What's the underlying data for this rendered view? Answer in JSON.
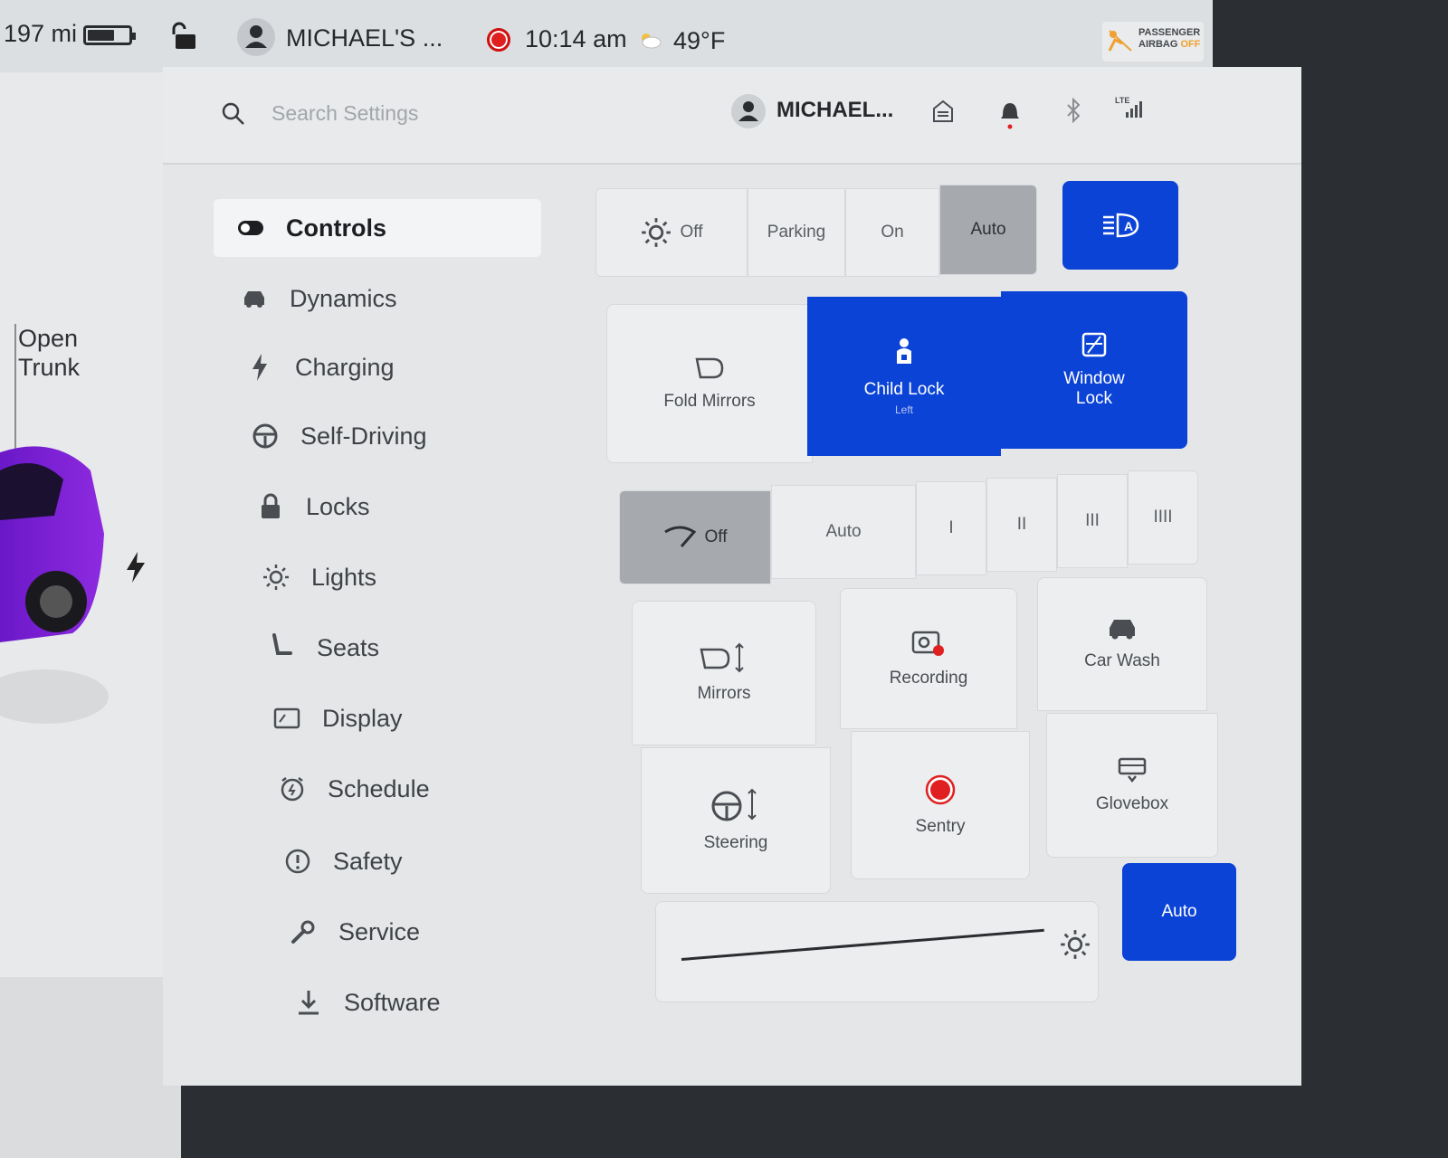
{
  "status_bar": {
    "range": "197 mi",
    "battery_level": 0.65,
    "profile": "MICHAEL'S ...",
    "time": "10:14 am",
    "temperature": "49°F",
    "airbag_line1": "PASSENGER",
    "airbag_line2": "AIRBAG",
    "airbag_state": "OFF"
  },
  "car_panel": {
    "trunk_line1": "Open",
    "trunk_line2": "Trunk"
  },
  "header": {
    "search_placeholder": "Search Settings",
    "profile_name": "MICHAEL...",
    "signal_label": "LTE"
  },
  "nav": {
    "items": [
      {
        "label": "Controls",
        "icon": "toggle-icon",
        "active": true
      },
      {
        "label": "Dynamics",
        "icon": "car-icon"
      },
      {
        "label": "Charging",
        "icon": "bolt-icon"
      },
      {
        "label": "Self-Driving",
        "icon": "steering-wheel-icon"
      },
      {
        "label": "Locks",
        "icon": "lock-icon"
      },
      {
        "label": "Lights",
        "icon": "sun-icon"
      },
      {
        "label": "Seats",
        "icon": "seat-icon"
      },
      {
        "label": "Display",
        "icon": "display-icon"
      },
      {
        "label": "Schedule",
        "icon": "alarm-clock-icon"
      },
      {
        "label": "Safety",
        "icon": "alert-circle-icon"
      },
      {
        "label": "Service",
        "icon": "wrench-icon"
      },
      {
        "label": "Software",
        "icon": "download-icon"
      }
    ]
  },
  "controls": {
    "headlights": {
      "options": [
        "Off",
        "Parking",
        "On",
        "Auto"
      ],
      "selected": "Auto",
      "auto_high_beam_icon": "auto-high-beam-icon"
    },
    "fold_mirrors": "Fold Mirrors",
    "child_lock": {
      "label": "Child Lock",
      "sub": "Left"
    },
    "window_lock": {
      "line1": "Window",
      "line2": "Lock"
    },
    "wipers": {
      "options": [
        "Off",
        "Auto",
        "I",
        "II",
        "III",
        "IIII"
      ],
      "selected": "Off"
    },
    "mirrors": "Mirrors",
    "recording": "Recording",
    "car_wash": "Car Wash",
    "steering": "Steering",
    "sentry": "Sentry",
    "glovebox": "Glovebox",
    "brightness_auto": "Auto"
  },
  "colors": {
    "accent_blue": "#0b43d6",
    "record_red": "#e02020",
    "panel_bg": "#e4e6e8"
  }
}
